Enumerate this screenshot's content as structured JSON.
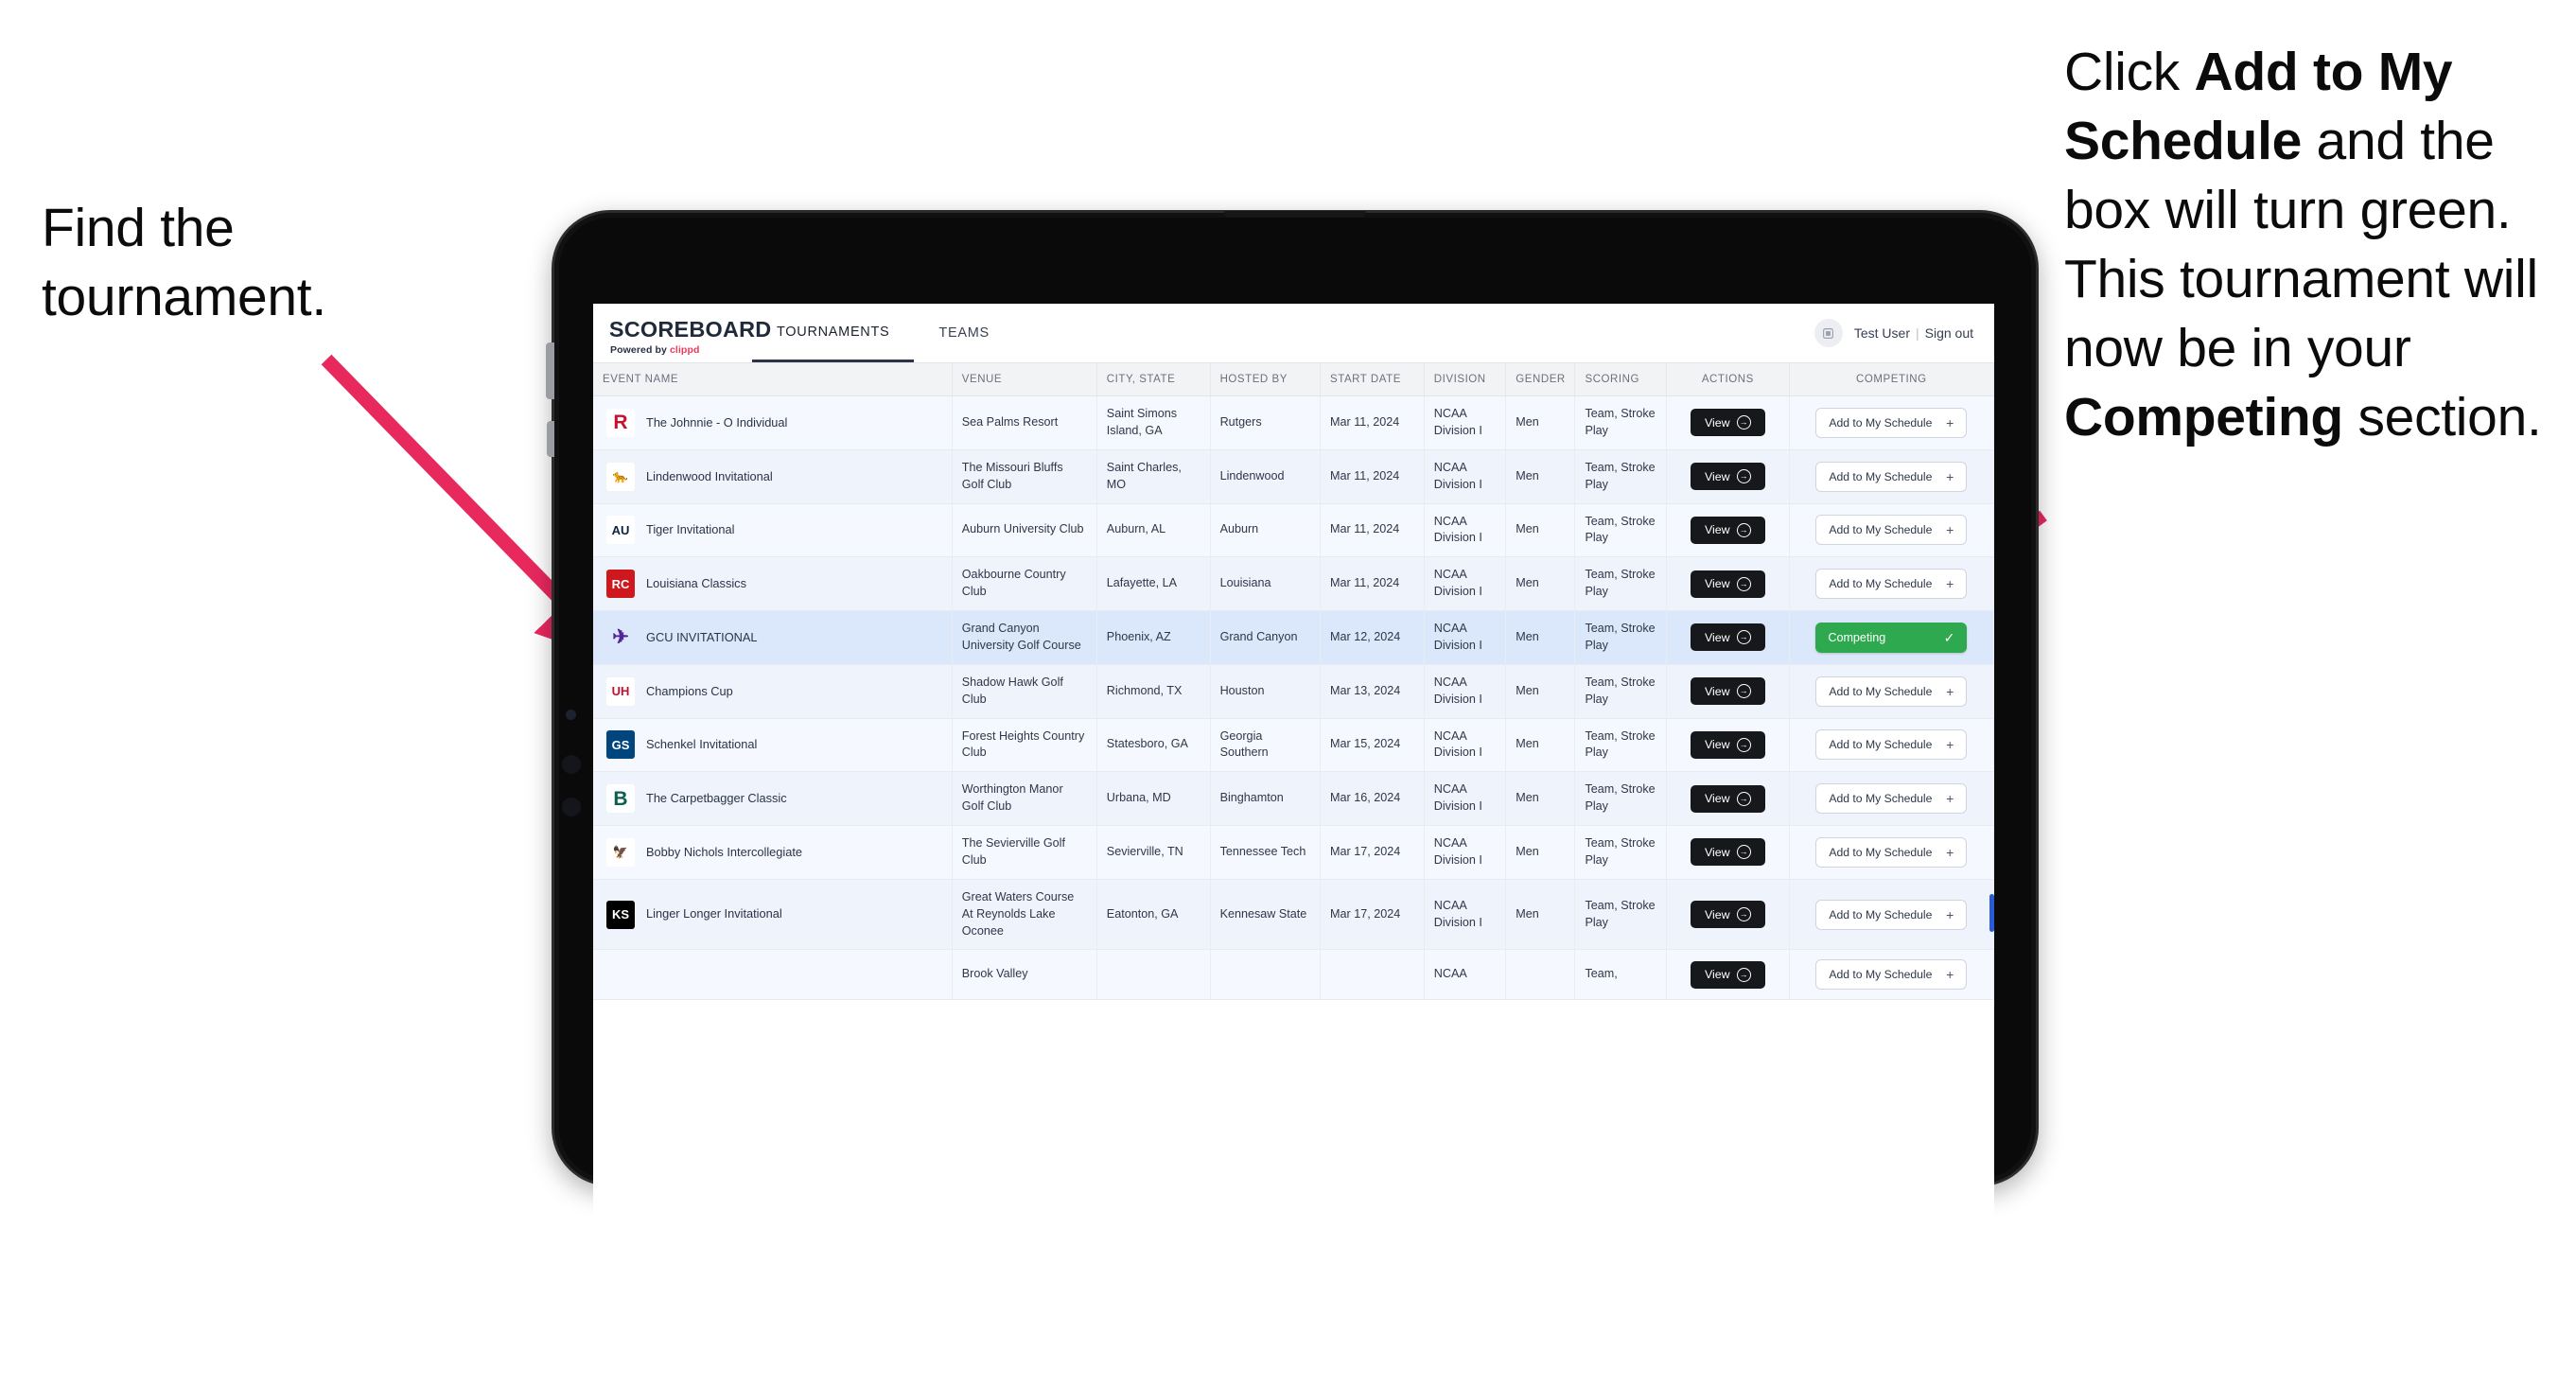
{
  "annotations": {
    "left": "Find the tournament.",
    "right_parts": [
      {
        "t": "Click ",
        "b": false
      },
      {
        "t": "Add to My Schedule",
        "b": true
      },
      {
        "t": " and the box will turn green. This tournament will now be in your ",
        "b": false
      },
      {
        "t": "Competing",
        "b": true
      },
      {
        "t": " section.",
        "b": false
      }
    ],
    "arrow_color": "#e8295e"
  },
  "app": {
    "brand": {
      "title": "SCOREBOARD",
      "powered_prefix": "Powered by ",
      "powered_name": "clippd"
    },
    "tabs": [
      {
        "label": "TOURNAMENTS",
        "active": true
      },
      {
        "label": "TEAMS",
        "active": false
      }
    ],
    "user": {
      "name": "Test User",
      "separator": "|",
      "signout": "Sign out",
      "avatar_icon": "user-avatar-icon"
    },
    "columns": [
      "EVENT NAME",
      "VENUE",
      "CITY, STATE",
      "HOSTED BY",
      "START DATE",
      "DIVISION",
      "GENDER",
      "SCORING",
      "ACTIONS",
      "COMPETING"
    ],
    "labels": {
      "view": "View",
      "add": "Add to My Schedule",
      "competing": "Competing",
      "plus": "+",
      "check": "✓"
    },
    "colors": {
      "competing_green": "#2fa94f",
      "view_black": "#17181c",
      "brand_pink": "#f2385a",
      "selected_row": "#dbe7fb"
    },
    "rows": [
      {
        "event": "The Johnnie - O Individual",
        "venue": "Sea Palms Resort",
        "city": "Saint Simons Island, GA",
        "host": "Rutgers",
        "date": "Mar 11, 2024",
        "division": "NCAA Division I",
        "gender": "Men",
        "scoring": "Team, Stroke Play",
        "competing": false,
        "logo": "R",
        "logo_color": "#c8102e",
        "logo_bg": "#ffffff"
      },
      {
        "event": "Lindenwood Invitational",
        "venue": "The Missouri Bluffs Golf Club",
        "city": "Saint Charles, MO",
        "host": "Lindenwood",
        "date": "Mar 11, 2024",
        "division": "NCAA Division I",
        "gender": "Men",
        "scoring": "Team, Stroke Play",
        "competing": false,
        "logo": "🐆",
        "logo_color": "#2b2b2b",
        "logo_bg": "#ffffff"
      },
      {
        "event": "Tiger Invitational",
        "venue": "Auburn University Club",
        "city": "Auburn, AL",
        "host": "Auburn",
        "date": "Mar 11, 2024",
        "division": "NCAA Division I",
        "gender": "Men",
        "scoring": "Team, Stroke Play",
        "competing": false,
        "logo": "AU",
        "logo_color": "#0c2340",
        "logo_bg": "#ffffff"
      },
      {
        "event": "Louisiana Classics",
        "venue": "Oakbourne Country Club",
        "city": "Lafayette, LA",
        "host": "Louisiana",
        "date": "Mar 11, 2024",
        "division": "NCAA Division I",
        "gender": "Men",
        "scoring": "Team, Stroke Play",
        "competing": false,
        "logo": "RC",
        "logo_color": "#ffffff",
        "logo_bg": "#ce181e"
      },
      {
        "event": "GCU INVITATIONAL",
        "venue": "Grand Canyon University Golf Course",
        "city": "Phoenix, AZ",
        "host": "Grand Canyon",
        "date": "Mar 12, 2024",
        "division": "NCAA Division I",
        "gender": "Men",
        "scoring": "Team, Stroke Play",
        "competing": true,
        "logo": "✈",
        "logo_color": "#522398",
        "logo_bg": "transparent"
      },
      {
        "event": "Champions Cup",
        "venue": "Shadow Hawk Golf Club",
        "city": "Richmond, TX",
        "host": "Houston",
        "date": "Mar 13, 2024",
        "division": "NCAA Division I",
        "gender": "Men",
        "scoring": "Team, Stroke Play",
        "competing": false,
        "logo": "UH",
        "logo_color": "#c8102e",
        "logo_bg": "#ffffff"
      },
      {
        "event": "Schenkel Invitational",
        "venue": "Forest Heights Country Club",
        "city": "Statesboro, GA",
        "host": "Georgia Southern",
        "date": "Mar 15, 2024",
        "division": "NCAA Division I",
        "gender": "Men",
        "scoring": "Team, Stroke Play",
        "competing": false,
        "logo": "GS",
        "logo_color": "#ffffff",
        "logo_bg": "#00457c"
      },
      {
        "event": "The Carpetbagger Classic",
        "venue": "Worthington Manor Golf Club",
        "city": "Urbana, MD",
        "host": "Binghamton",
        "date": "Mar 16, 2024",
        "division": "NCAA Division I",
        "gender": "Men",
        "scoring": "Team, Stroke Play",
        "competing": false,
        "logo": "B",
        "logo_color": "#0d5e4f",
        "logo_bg": "#ffffff"
      },
      {
        "event": "Bobby Nichols Intercollegiate",
        "venue": "The Sevierville Golf Club",
        "city": "Sevierville, TN",
        "host": "Tennessee Tech",
        "date": "Mar 17, 2024",
        "division": "NCAA Division I",
        "gender": "Men",
        "scoring": "Team, Stroke Play",
        "competing": false,
        "logo": "🦅",
        "logo_color": "#43256b",
        "logo_bg": "#ffffff"
      },
      {
        "event": "Linger Longer Invitational",
        "venue": "Great Waters Course At Reynolds Lake Oconee",
        "city": "Eatonton, GA",
        "host": "Kennesaw State",
        "date": "Mar 17, 2024",
        "division": "NCAA Division I",
        "gender": "Men",
        "scoring": "Team, Stroke Play",
        "competing": false,
        "logo": "KS",
        "logo_color": "#ffffff",
        "logo_bg": "#000000"
      },
      {
        "event": "",
        "venue": "Brook Valley",
        "city": "",
        "host": "",
        "date": "",
        "division": "NCAA",
        "gender": "",
        "scoring": "Team,",
        "competing": false,
        "logo": "",
        "logo_color": "#43256b",
        "logo_bg": "transparent"
      }
    ]
  }
}
